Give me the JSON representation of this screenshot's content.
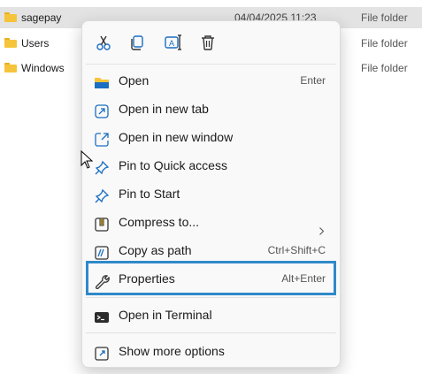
{
  "explorer": {
    "rows": [
      {
        "name": "sagepay",
        "date": "04/04/2025 11:23",
        "type": "File folder"
      },
      {
        "name": "Users",
        "date": "",
        "type": "File folder"
      },
      {
        "name": "Windows",
        "date": "",
        "type": "File folder"
      }
    ]
  },
  "context_menu": {
    "toolbar": [
      "cut-icon",
      "copy-icon",
      "rename-icon",
      "delete-icon"
    ],
    "items": [
      {
        "label": "Open",
        "shortcut": "Enter",
        "icon": "folder-open-icon"
      },
      {
        "label": "Open in new tab",
        "shortcut": "",
        "icon": "new-tab-icon"
      },
      {
        "label": "Open in new window",
        "shortcut": "",
        "icon": "new-window-icon"
      },
      {
        "label": "Pin to Quick access",
        "shortcut": "",
        "icon": "pin-icon"
      },
      {
        "label": "Pin to Start",
        "shortcut": "",
        "icon": "pin-icon"
      },
      {
        "label": "Compress to...",
        "shortcut": "",
        "icon": "zip-icon"
      },
      {
        "label": "Copy as path",
        "shortcut": "Ctrl+Shift+C",
        "icon": "copy-path-icon"
      },
      {
        "label": "Properties",
        "shortcut": "Alt+Enter",
        "icon": "wrench-icon"
      },
      {
        "label": "Open in Terminal",
        "shortcut": "",
        "icon": "terminal-icon"
      },
      {
        "label": "Show more options",
        "shortcut": "",
        "icon": "more-options-icon"
      }
    ]
  },
  "colors": {
    "highlight": "#2f89c9",
    "accent": "#1b6ec2",
    "folder": "#f6c43a"
  }
}
